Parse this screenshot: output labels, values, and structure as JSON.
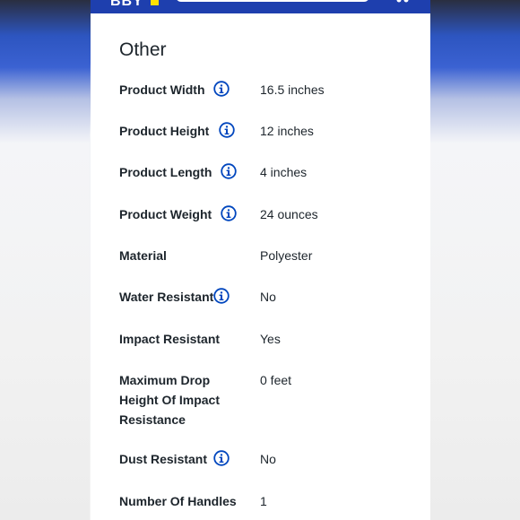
{
  "section": {
    "title": "Other"
  },
  "specs": [
    {
      "label": "Product Width",
      "value": "16.5 inches",
      "info": true
    },
    {
      "label": "Product Height",
      "value": "12 inches",
      "info": true
    },
    {
      "label": "Product Length",
      "value": "4 inches",
      "info": true
    },
    {
      "label": "Product Weight",
      "value": "24 ounces",
      "info": true
    },
    {
      "label": "Material",
      "value": "Polyester",
      "info": false
    },
    {
      "label": "Water Resistant",
      "value": "No",
      "info": true
    },
    {
      "label": "Impact Resistant",
      "value": "Yes",
      "info": false
    },
    {
      "label": "Maximum Drop Height Of Impact Resistance",
      "value": "0 feet",
      "info": false
    },
    {
      "label": "Dust Resistant",
      "value": "No",
      "info": true
    },
    {
      "label": "Number Of Handles",
      "value": "1",
      "info": false
    }
  ],
  "colors": {
    "header_blue": "#1e3fae",
    "logo_yellow": "#ffe000",
    "info_icon": "#0046be",
    "text": "#1d252c"
  },
  "icons": {
    "info": "info-circle-icon",
    "cart": "cart-icon"
  }
}
